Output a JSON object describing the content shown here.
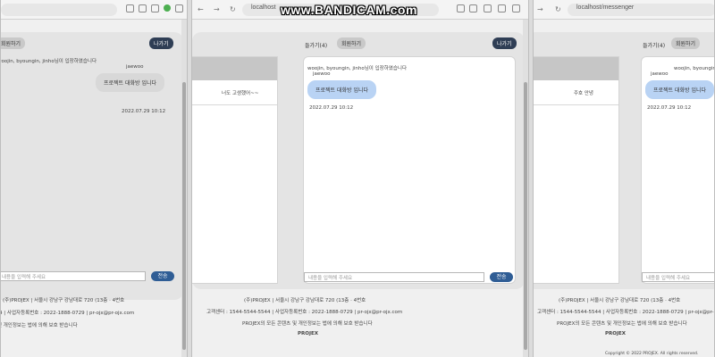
{
  "watermark": "www.BANDICAM.com",
  "addr": {
    "url": "localhost",
    "path": "/messenger"
  },
  "chat": {
    "members_chip": "들가기(4)",
    "invite_chip": "회원하기",
    "leave_button": "나가기",
    "join_notice": "woojin, byoungin, jinho님이 입장하였습니다",
    "sender": "jaewoo",
    "message": "프로젝트 대화방 입니다",
    "timestamp": "2022.07.29 10:12",
    "room_preview": "너도 고생했어~~",
    "room_preview_short": "주호 안녕",
    "input_placeholder": "내용을 입력해 주세요",
    "send_label": "전송"
  },
  "footer": {
    "line1": "(주)PROJEX | 서울시 강남구 강남대로 720 (13층 · 4번호",
    "line2": "고객센터 : 1544-5544-5544 | 사업자등록번호 : 2022-1888-0729 | pr-ojx@pr-ojx.com",
    "line3": "PROJEX의 모든 콘텐츠 및 개인정보는 법에 의해 보호 받습니다",
    "brand": "PROJEX",
    "copyright": "Copyright © 2022 PROJEX. All rights reserved."
  }
}
